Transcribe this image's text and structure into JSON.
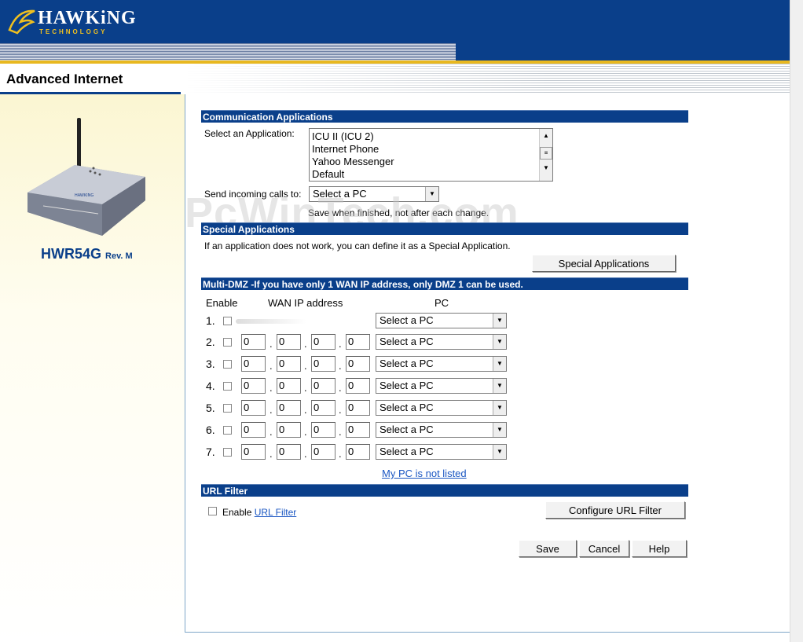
{
  "brand": {
    "name": "HAWKiNG",
    "tagline": "TECHNOLOGY"
  },
  "page_title": "Advanced Internet",
  "model": {
    "name": "HWR54G",
    "revision": "Rev. M"
  },
  "watermark": "PcWinTech.com",
  "communication": {
    "header": "Communication Applications",
    "select_label": "Select an Application:",
    "applications": [
      "ICU II (ICU 2)",
      "Internet Phone",
      "Yahoo Messenger",
      "Default"
    ],
    "send_label": "Send incoming calls to:",
    "send_value": "Select a PC",
    "note": "Save when finished, not after each change."
  },
  "special": {
    "header": "Special Applications",
    "text": "If an application does not work, you can define it as a Special Application.",
    "button": "Special Applications"
  },
  "dmz": {
    "header": "Multi-DMZ -If you have only 1 WAN IP address, only DMZ 1 can be used.",
    "col_enable": "Enable",
    "col_wan": "WAN IP address",
    "col_pc": "PC",
    "rows": [
      {
        "num": "1.",
        "ip": [
          "",
          "",
          "",
          ""
        ],
        "pc": "Select a PC"
      },
      {
        "num": "2.",
        "ip": [
          "0",
          "0",
          "0",
          "0"
        ],
        "pc": "Select a PC"
      },
      {
        "num": "3.",
        "ip": [
          "0",
          "0",
          "0",
          "0"
        ],
        "pc": "Select a PC"
      },
      {
        "num": "4.",
        "ip": [
          "0",
          "0",
          "0",
          "0"
        ],
        "pc": "Select a PC"
      },
      {
        "num": "5.",
        "ip": [
          "0",
          "0",
          "0",
          "0"
        ],
        "pc": "Select a PC"
      },
      {
        "num": "6.",
        "ip": [
          "0",
          "0",
          "0",
          "0"
        ],
        "pc": "Select a PC"
      },
      {
        "num": "7.",
        "ip": [
          "0",
          "0",
          "0",
          "0"
        ],
        "pc": "Select a PC"
      }
    ],
    "pc_not_listed": "My PC is not listed"
  },
  "url_filter": {
    "header": "URL Filter",
    "enable_label": "Enable",
    "link": "URL Filter",
    "button": "Configure URL Filter"
  },
  "actions": {
    "save": "Save",
    "cancel": "Cancel",
    "help": "Help"
  },
  "colors": {
    "brand_blue": "#0a3f8a",
    "gold": "#e8b820",
    "link": "#1a56c2"
  }
}
